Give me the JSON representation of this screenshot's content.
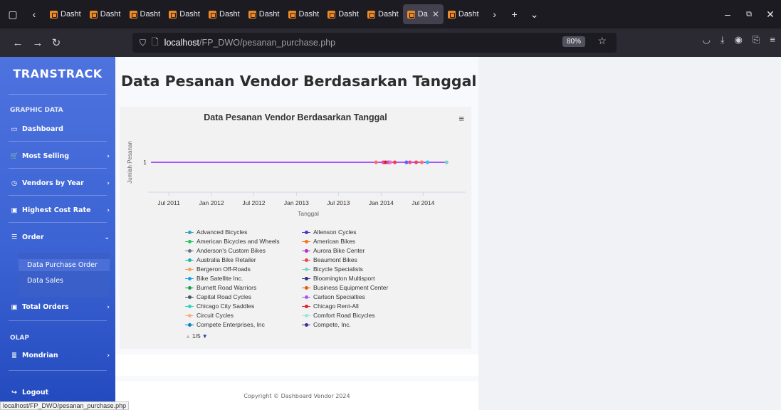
{
  "browser": {
    "tabs": [
      {
        "label": "Dasht",
        "active": false
      },
      {
        "label": "Dasht",
        "active": false
      },
      {
        "label": "Dasht",
        "active": false
      },
      {
        "label": "Dasht",
        "active": false
      },
      {
        "label": "Dasht",
        "active": false
      },
      {
        "label": "Dasht",
        "active": false
      },
      {
        "label": "Dasht",
        "active": false
      },
      {
        "label": "Dasht",
        "active": false
      },
      {
        "label": "Dasht",
        "active": false
      },
      {
        "label": "Da",
        "active": true
      },
      {
        "label": "Dasht",
        "active": false
      }
    ],
    "url_host": "localhost",
    "url_path": "/FP_DWO/pesanan_purchase.php",
    "zoom": "80%",
    "status_url": "localhost/FP_DWO/pesanan_purchase.php"
  },
  "sidebar": {
    "brand": "TRANSTRACK",
    "heading_graphic": "GRAPHIC DATA",
    "heading_olap": "OLAP",
    "items": {
      "dashboard": "Dashboard",
      "most_selling": "Most Selling",
      "vendors_by_year": "Vendors by Year",
      "highest_cost": "Highest Cost Rate",
      "order": "Order",
      "total_orders": "Total Orders",
      "mondrian": "Mondrian",
      "logout": "Logout"
    },
    "submenu": {
      "purchase_order": "Data Purchase Order",
      "sales": "Data Sales"
    }
  },
  "main": {
    "page_title": "Data Pesanan Vendor Berdasarkan Tanggal",
    "footer": "Copyright © Dashboard Vendor 2024"
  },
  "chart_data": {
    "type": "scatter",
    "title": "Data Pesanan Vendor Berdasarkan Tanggal",
    "xlabel": "Tanggal",
    "ylabel": "Jumlah Pesanan",
    "x_ticks": [
      "Jul 2011",
      "Jan 2012",
      "Jul 2012",
      "Jan 2013",
      "Jul 2013",
      "Jan 2014",
      "Jul 2014"
    ],
    "y_ticks": [
      "1"
    ],
    "x_range": [
      "2011-04-15",
      "2014-12-31"
    ],
    "y_value": 1,
    "line_color": "#a855f7",
    "points": [
      {
        "x": "2013-12-10",
        "color": "#f87171"
      },
      {
        "x": "2014-01-10",
        "color": "#ec4899"
      },
      {
        "x": "2014-01-20",
        "color": "#dc2626"
      },
      {
        "x": "2014-02-01",
        "color": "#a855f7"
      },
      {
        "x": "2014-02-10",
        "color": "#f472b6"
      },
      {
        "x": "2014-03-01",
        "color": "#f43f5e"
      },
      {
        "x": "2014-04-20",
        "color": "#6366f1"
      },
      {
        "x": "2014-05-05",
        "color": "#ec4899"
      },
      {
        "x": "2014-06-01",
        "color": "#f43f5e"
      },
      {
        "x": "2014-06-25",
        "color": "#f87171"
      },
      {
        "x": "2014-07-20",
        "color": "#38bdf8"
      },
      {
        "x": "2014-10-10",
        "color": "#7dd3c9"
      }
    ],
    "legend": [
      {
        "name": "Advanced Bicycles",
        "color": "#36a2c8"
      },
      {
        "name": "Allenson Cycles",
        "color": "#4338ca"
      },
      {
        "name": "American Bicycles and Wheels",
        "color": "#22c55e"
      },
      {
        "name": "American Bikes",
        "color": "#f97316"
      },
      {
        "name": "Anderson's Custom Bikes",
        "color": "#64748b"
      },
      {
        "name": "Aurora Bike Center",
        "color": "#c026d3"
      },
      {
        "name": "Australia Bike Retailer",
        "color": "#14b8a6"
      },
      {
        "name": "Beaumont Bikes",
        "color": "#ef4444"
      },
      {
        "name": "Bergeron Off-Roads",
        "color": "#f4a261"
      },
      {
        "name": "Bicycle Specialists",
        "color": "#7dd3c9"
      },
      {
        "name": "Bike Satellite Inc.",
        "color": "#0ea5e9"
      },
      {
        "name": "Bloomington Multisport",
        "color": "#312e81"
      },
      {
        "name": "Burnett Road Warriors",
        "color": "#16a34a"
      },
      {
        "name": "Business Equipment Center",
        "color": "#ea580c"
      },
      {
        "name": "Capital Road Cycles",
        "color": "#475569"
      },
      {
        "name": "Carlson Specialties",
        "color": "#a855f7"
      },
      {
        "name": "Chicago City Saddles",
        "color": "#2dd4bf"
      },
      {
        "name": "Chicago Rent-All",
        "color": "#dc2626"
      },
      {
        "name": "Circuit Cycles",
        "color": "#f4b183"
      },
      {
        "name": "Comfort Road Bicycles",
        "color": "#99e6dd"
      },
      {
        "name": "Compete Enterprises, Inc",
        "color": "#0284c7"
      },
      {
        "name": "Compete, Inc.",
        "color": "#3730a3"
      }
    ],
    "legend_page": "1/5",
    "grid": false
  }
}
